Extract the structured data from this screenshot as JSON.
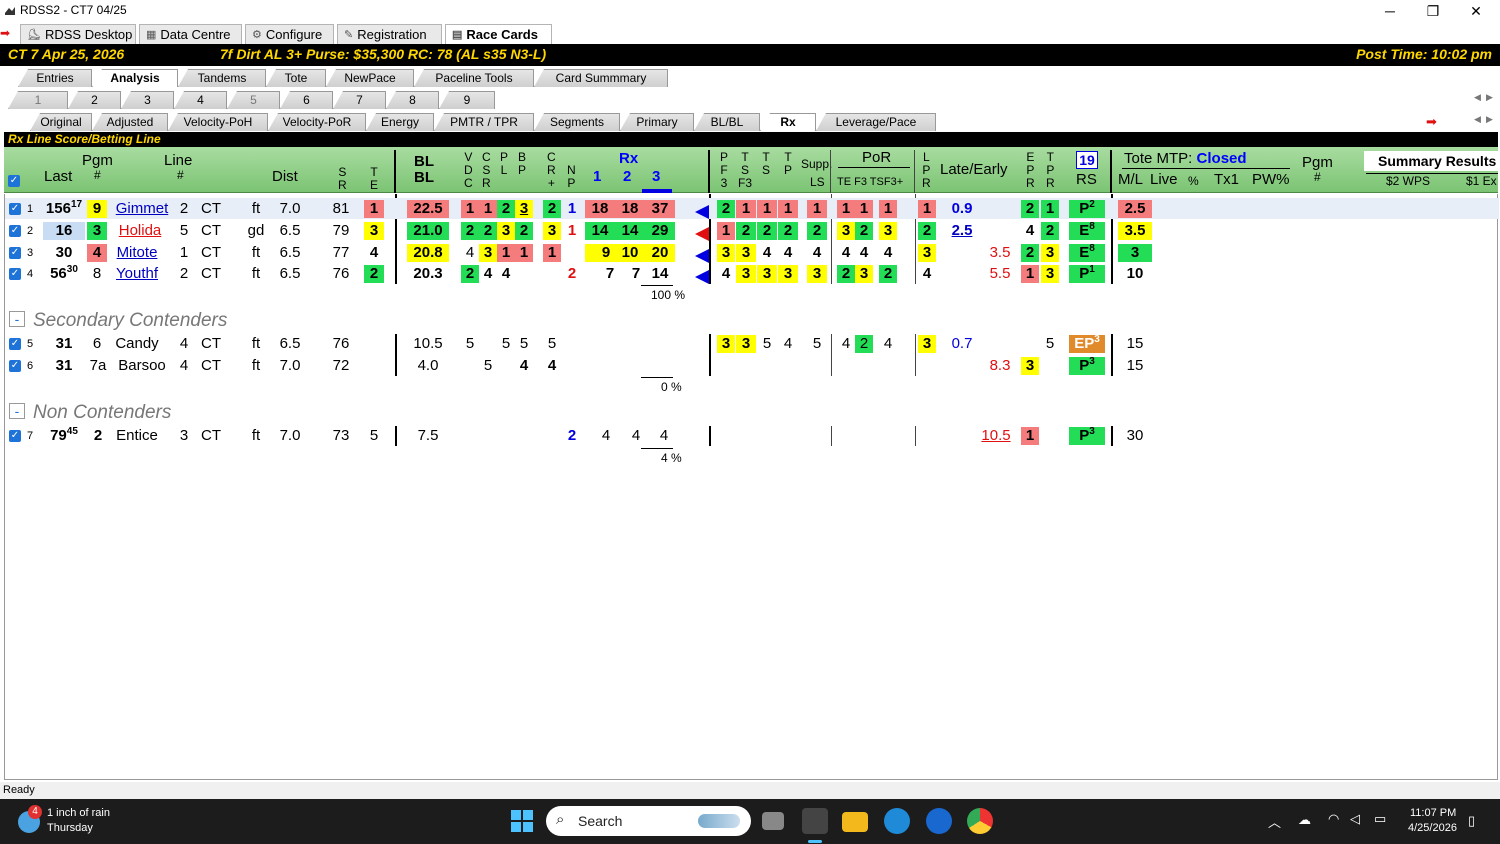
{
  "window": {
    "title": "RDSS2 - CT7  04/25"
  },
  "nav_tabs": [
    {
      "label": "RDSS Desktop",
      "icon": "rdss-icon"
    },
    {
      "label": "Data Centre",
      "icon": "data-icon"
    },
    {
      "label": "Configure",
      "icon": "gear-icon"
    },
    {
      "label": "Registration",
      "icon": "registration-icon"
    },
    {
      "label": "Race Cards",
      "icon": "cards-icon"
    }
  ],
  "race": {
    "id": "CT 7  Apr 25, 2026",
    "info": "7f Dirt  AL  3+  Purse: $35,300  RC: 78  (AL s35 N3-L)",
    "post_time": "Post Time: 10:02 pm"
  },
  "main_tabs": [
    "Entries",
    "Analysis",
    "Tandems",
    "Tote",
    "NewPace",
    "Paceline Tools",
    "Card Summmary"
  ],
  "race_tabs": [
    "1",
    "2",
    "3",
    "4",
    "5",
    "6",
    "7",
    "8",
    "9"
  ],
  "view_tabs": [
    "Original",
    "Adjusted",
    "Velocity-PoH",
    "Velocity-PoR",
    "Energy",
    "PMTR / TPR",
    "Segments",
    "Primary",
    "BL/BL",
    "Rx",
    "Leverage/Pace"
  ],
  "section_title": "Rx Line Score/Betting Line",
  "headers": {
    "last": "Last",
    "pgm": "Pgm",
    "hash": "#",
    "line": "Line",
    "dist": "Dist",
    "sr": [
      "S",
      "R"
    ],
    "te": [
      "T",
      "E"
    ],
    "blbl": [
      "BL",
      "BL"
    ],
    "vdc": [
      "V",
      "D",
      "C"
    ],
    "csr": [
      "C",
      "S",
      "R"
    ],
    "pl": [
      "P",
      "L"
    ],
    "bp": [
      "B",
      "P"
    ],
    "cr": [
      "C",
      "R",
      "+"
    ],
    "np": [
      "N",
      "P"
    ],
    "rx": "Rx",
    "rx_cols": [
      "1",
      "2",
      "3"
    ],
    "pf3": [
      "P",
      "F",
      "3"
    ],
    "tsf3": [
      "T",
      "S",
      "F3"
    ],
    "ts": [
      "T",
      "S"
    ],
    "tp": [
      "T",
      "P"
    ],
    "supp": "Supp.",
    "ls": "LS",
    "por": "PoR",
    "por_sub": "TE F3 TSF3+",
    "lpr": [
      "L",
      "P",
      "R"
    ],
    "late_early": "Late/Early",
    "epr": [
      "E",
      "P",
      "R"
    ],
    "tpr": [
      "T",
      "P",
      "R"
    ],
    "rs_box": "19",
    "rs": "RS",
    "tote_mtp": "Tote MTP:",
    "tote_status": "Closed",
    "ml": "M/L",
    "live": "Live",
    "pct": "%",
    "tx1": "Tx1",
    "pw": "PW%",
    "pgm2": "Pgm",
    "hash2": "#",
    "summary": "Summary Results",
    "wps": "$2 WPS",
    "ex": "$1 Ex"
  },
  "rows": [
    {
      "n": "1",
      "last": "156",
      "last_sup": "17",
      "pgm": "9",
      "name": "Gimmet",
      "line": "2",
      "trk": "CT",
      "cond": "ft",
      "dist": "7.0",
      "sr": "81",
      "te": "1",
      "bl": "22.5",
      "v": "1",
      "c": "1",
      "p": "2",
      "b": "3",
      "cr": "2",
      "np": "1",
      "rx1": "18",
      "rx2": "18",
      "rx3": "37",
      "pf": "2",
      "ts1": "1",
      "ts2": "1",
      "tp": "1",
      "ls": "1",
      "por1": "1",
      "por2": "1",
      "por3": "1",
      "lpr": "1",
      "late": "0.9",
      "early": "",
      "epr": "2",
      "tpr": "1",
      "rs": "P",
      "rs_sup": "2",
      "ml": "2.5"
    },
    {
      "n": "2",
      "last": "16",
      "last_sup": "",
      "pgm": "3",
      "name": "Holida",
      "line": "5",
      "trk": "CT",
      "cond": "gd",
      "dist": "6.5",
      "sr": "79",
      "te": "3",
      "bl": "21.0",
      "v": "2",
      "c": "2",
      "p": "3",
      "b": "2",
      "cr": "3",
      "np": "1",
      "rx1": "14",
      "rx2": "14",
      "rx3": "29",
      "pf": "1",
      "ts1": "2",
      "ts2": "2",
      "tp": "2",
      "ls": "2",
      "por1": "3",
      "por2": "2",
      "por3": "3",
      "lpr": "2",
      "late": "2.5",
      "early": "",
      "epr": "4",
      "tpr": "2",
      "rs": "E",
      "rs_sup": "8",
      "ml": "3.5"
    },
    {
      "n": "3",
      "last": "30",
      "last_sup": "",
      "pgm": "4",
      "name": "Mitote",
      "line": "1",
      "trk": "CT",
      "cond": "ft",
      "dist": "6.5",
      "sr": "77",
      "te": "4",
      "bl": "20.8",
      "v": "4",
      "c": "3",
      "p": "1",
      "b": "1",
      "cr": "1",
      "np": "",
      "rx1": "9",
      "rx2": "10",
      "rx3": "20",
      "pf": "3",
      "ts1": "3",
      "ts2": "4",
      "tp": "4",
      "ls": "4",
      "por1": "4",
      "por2": "4",
      "por3": "4",
      "lpr": "3",
      "late": "",
      "early": "3.5",
      "epr": "2",
      "tpr": "3",
      "rs": "E",
      "rs_sup": "8",
      "ml": "3"
    },
    {
      "n": "4",
      "last": "56",
      "last_sup": "30",
      "pgm": "8",
      "name": "Youthf",
      "line": "2",
      "trk": "CT",
      "cond": "ft",
      "dist": "6.5",
      "sr": "76",
      "te": "2",
      "bl": "20.3",
      "v": "2",
      "c": "4",
      "p": "4",
      "b": "",
      "cr": "",
      "np": "2",
      "rx1": "7",
      "rx2": "7",
      "rx3": "14",
      "pf": "4",
      "ts1": "3",
      "ts2": "3",
      "tp": "3",
      "ls": "3",
      "por1": "2",
      "por2": "3",
      "por3": "2",
      "lpr": "4",
      "late": "",
      "early": "5.5",
      "epr": "1",
      "tpr": "3",
      "rs": "P",
      "rs_sup": "1",
      "ml": "10"
    }
  ],
  "group1_pct": "100 %",
  "secondary_title": "Secondary Contenders",
  "secondary": [
    {
      "n": "5",
      "last": "31",
      "pgm": "6",
      "name": "Candy",
      "line": "4",
      "trk": "CT",
      "cond": "ft",
      "dist": "6.5",
      "sr": "76",
      "bl": "10.5",
      "v": "5",
      "p": "5",
      "b": "5",
      "cr": "5",
      "pf": "3",
      "ts1": "3",
      "ts2": "5",
      "tp": "4",
      "ls": "5",
      "por1": "4",
      "por2": "2",
      "por3": "4",
      "lpr": "3",
      "late": "0.7",
      "epr": "5",
      "rs": "EP",
      "rs_sup": "3",
      "ml": "15"
    },
    {
      "n": "6",
      "last": "31",
      "pgm": "7a",
      "name": "Barsoo",
      "line": "4",
      "trk": "CT",
      "cond": "ft",
      "dist": "7.0",
      "sr": "72",
      "bl": "4.0",
      "c": "5",
      "b": "4",
      "cr": "4",
      "early": "8.3",
      "epr": "3",
      "rs": "P",
      "rs_sup": "3",
      "ml": "15"
    }
  ],
  "group2_pct": "0 %",
  "non_title": "Non Contenders",
  "non": [
    {
      "n": "7",
      "last": "79",
      "last_sup": "45",
      "pgm": "2",
      "name": "Entice",
      "line": "3",
      "trk": "CT",
      "cond": "ft",
      "dist": "7.0",
      "sr": "73",
      "te": "5",
      "bl": "7.5",
      "np": "2",
      "rx1": "4",
      "rx2": "4",
      "rx3": "4",
      "early": "10.5",
      "epr": "1",
      "rs": "P",
      "rs_sup": "3",
      "ml": "30"
    }
  ],
  "group3_pct": "4 %",
  "status": "Ready",
  "taskbar": {
    "weather_badge": "4",
    "weather_line1": "1 inch of rain",
    "weather_line2": "Thursday",
    "search": "Search",
    "time": "11:07 PM",
    "date": "4/25/2026"
  },
  "colors": {
    "yellow": "#ffff00",
    "green": "#22dd55",
    "red": "#f47c7c",
    "orange": "#e08a2c",
    "header_green": "#8fd086"
  }
}
